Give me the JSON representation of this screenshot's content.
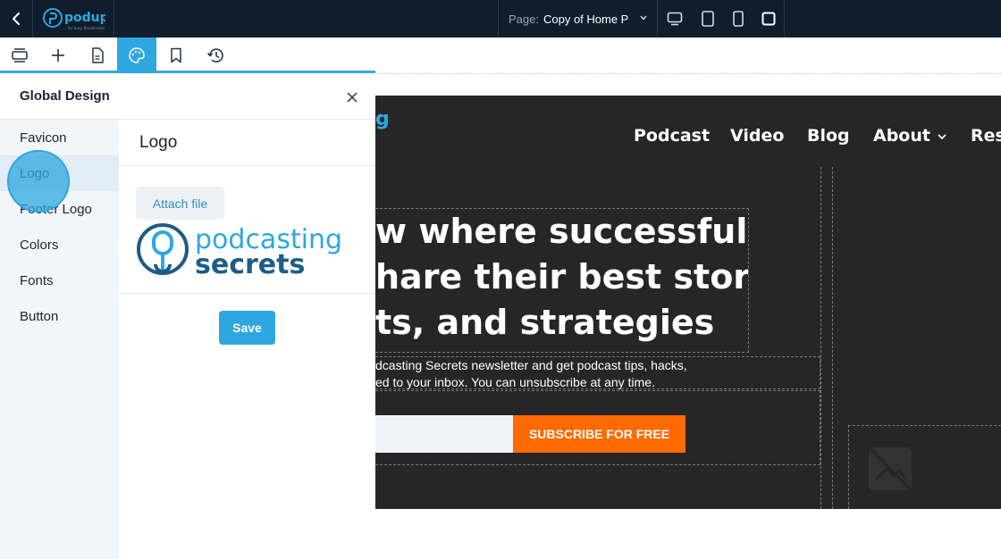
{
  "topbar": {
    "back_icon": "chevron-left-icon",
    "logo_text": "podup",
    "logo_tagline": "for busy Broadcasters",
    "page_label": "Page:",
    "page_value": "Copy of Home P",
    "devices": [
      "desktop-icon",
      "tablet-landscape-icon",
      "tablet-portrait-icon",
      "mobile-icon"
    ]
  },
  "toolbar": {
    "tools": [
      "layers-icon",
      "add-icon",
      "page-icon",
      "palette-icon",
      "bookmark-icon",
      "history-icon"
    ],
    "active": "palette-icon"
  },
  "panel": {
    "title": "Global Design",
    "sidebar": {
      "items": [
        {
          "label": "Favicon"
        },
        {
          "label": "Logo"
        },
        {
          "label": "Footer Logo"
        },
        {
          "label": "Colors"
        },
        {
          "label": "Fonts"
        },
        {
          "label": "Button"
        }
      ],
      "active": "Logo"
    },
    "content": {
      "title": "Logo",
      "attach_label": "Attach file",
      "logo_word1": "podcasting",
      "logo_word2": "secrets",
      "save_label": "Save"
    }
  },
  "site_preview": {
    "brand_fragment": "g",
    "nav": [
      {
        "label": "Podcast"
      },
      {
        "label": "Video"
      },
      {
        "label": "Blog"
      },
      {
        "label": "About"
      },
      {
        "label": "Res"
      }
    ],
    "headline": [
      "w where successful",
      "hare their best stories,",
      "ts, and strategies"
    ],
    "newsletter": [
      "dcasting Secrets newsletter and get podcast tips, hacks,",
      "ed to your inbox. You can unsubscribe at any time."
    ],
    "subscribe_label": "SUBSCRIBE FOR FREE",
    "colors": {
      "accent": "#2ea7e0",
      "cta": "#ff6a00",
      "site_bg": "#262626"
    }
  }
}
